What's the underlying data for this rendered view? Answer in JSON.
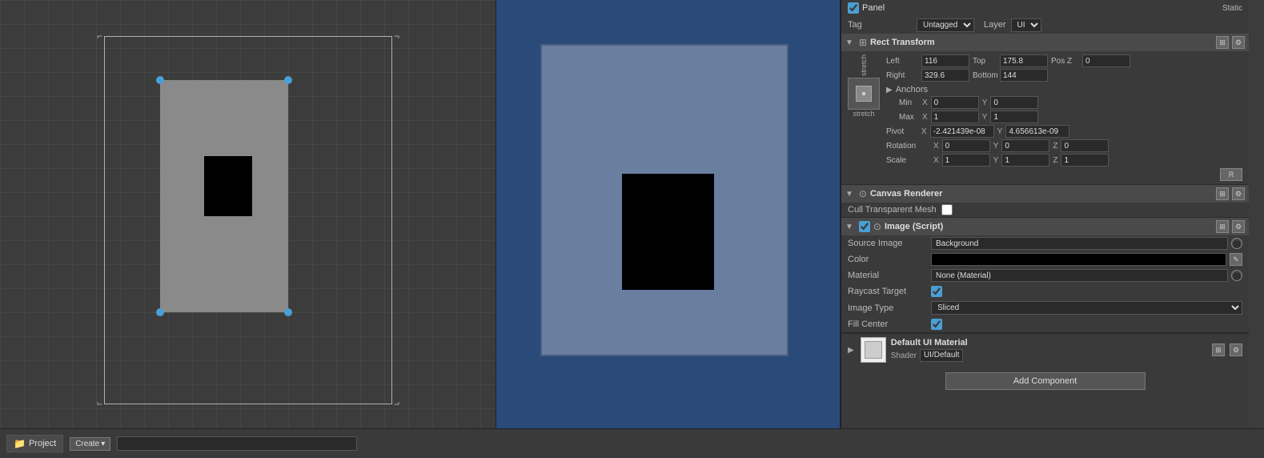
{
  "inspector": {
    "panel_label": "Panel",
    "static_label": "Static",
    "tag_label": "Tag",
    "tag_value": "Untagged",
    "layer_label": "Layer",
    "layer_value": "UI",
    "rect_transform": {
      "title": "Rect Transform",
      "stretch_label": "stretch",
      "left_label": "Left",
      "left_value": "116",
      "top_label": "Top",
      "top_value": "175.8",
      "pos_z_label": "Pos Z",
      "pos_z_value": "0",
      "right_label": "Right",
      "right_value": "329.6",
      "bottom_label": "Bottom",
      "bottom_value": "144",
      "anchors_label": "Anchors",
      "min_label": "Min",
      "min_x": "0",
      "min_y": "0",
      "max_label": "Max",
      "max_x": "1",
      "max_y": "1",
      "pivot_label": "Pivot",
      "pivot_x": "-2.421439e-08",
      "pivot_y": "4.656613e-09",
      "rotation_label": "Rotation",
      "rot_x": "0",
      "rot_y": "0",
      "rot_z": "0",
      "scale_label": "Scale",
      "scale_x": "1",
      "scale_y": "1",
      "scale_z": "1"
    },
    "canvas_renderer": {
      "title": "Canvas Renderer",
      "cull_label": "Cull Transparent Mesh"
    },
    "image_script": {
      "title": "Image (Script)",
      "source_image_label": "Source Image",
      "source_image_value": "Background",
      "color_label": "Color",
      "material_label": "Material",
      "material_value": "None (Material)",
      "raycast_label": "Raycast Target",
      "image_type_label": "Image Type",
      "image_type_value": "Sliced",
      "fill_center_label": "Fill Center"
    },
    "default_material": {
      "title": "Default UI Material",
      "shader_label": "Shader",
      "shader_value": "UI/Default"
    },
    "add_component_label": "Add Component"
  },
  "bottom_bar": {
    "project_tab": "Project",
    "create_btn": "Create",
    "create_arrow": "▾",
    "search_placeholder": ""
  },
  "icons": {
    "checkbox_checked": "✓",
    "dropdown_arrow": "▼",
    "small_arrow_right": "▶",
    "small_arrow_down": "▼",
    "collapse_arrow": "▼",
    "section_icon": "⊙",
    "gear": "⚙",
    "lock": "⊞",
    "overflow": "≡"
  }
}
